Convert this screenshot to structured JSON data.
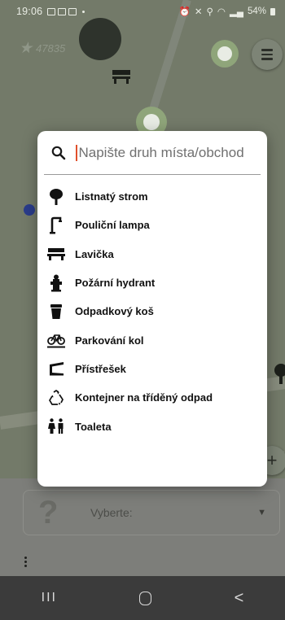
{
  "status_bar": {
    "time": "19:06",
    "battery": "54%"
  },
  "map": {
    "star_count": "47835",
    "menu_icon": "hamburger-menu-icon",
    "plus_label": "+"
  },
  "dialog": {
    "search": {
      "placeholder": "Napište druh místa/obchod",
      "icon": "search-icon"
    },
    "items": [
      {
        "label": "Listnatý strom",
        "icon": "tree-icon"
      },
      {
        "label": "Pouliční lampa",
        "icon": "street-lamp-icon"
      },
      {
        "label": "Lavička",
        "icon": "bench-icon"
      },
      {
        "label": "Požární hydrant",
        "icon": "fire-hydrant-icon"
      },
      {
        "label": "Odpadkový koš",
        "icon": "waste-basket-icon"
      },
      {
        "label": "Parkování kol",
        "icon": "bicycle-parking-icon"
      },
      {
        "label": "Přístřešek",
        "icon": "shelter-icon"
      },
      {
        "label": "Kontejner na tříděný odpad",
        "icon": "recycling-icon"
      },
      {
        "label": "Toaleta",
        "icon": "toilets-icon"
      }
    ]
  },
  "bottom_panel": {
    "select_icon_label": "?",
    "select_label": "Vyberte:"
  },
  "navbar": {
    "recent_label": "III",
    "back_label": "<"
  }
}
